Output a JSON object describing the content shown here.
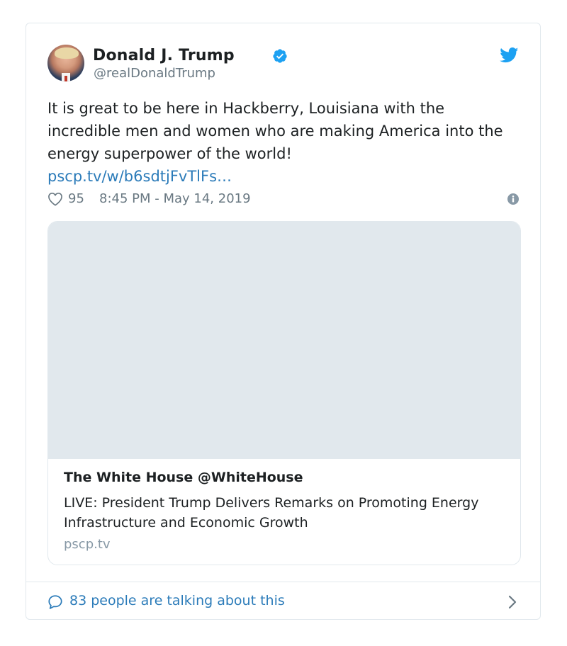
{
  "author": {
    "name": "Donald J. Trump",
    "handle": "@realDonaldTrump"
  },
  "tweet": {
    "text": "It is great to be here in Hackberry, Louisiana with the incredible men and women who are making America into the energy superpower of the world!",
    "link": "pscp.tv/w/b6sdtjFvTlFs…"
  },
  "meta": {
    "like_count": "95",
    "timestamp": "8:45 PM - May 14, 2019"
  },
  "card": {
    "title": "The White House @WhiteHouse",
    "description": "LIVE: President Trump Delivers Remarks on Promoting Energy Infrastructure and Economic Growth",
    "domain": "pscp.tv"
  },
  "footer": {
    "talking": "83 people are talking about this"
  },
  "colors": {
    "link": "#2b7bb9",
    "twitter_blue": "#1da1f2",
    "muted": "#697882",
    "border": "#e1e8ed"
  },
  "icons": {
    "verified": "verified-badge-icon",
    "brand": "twitter-bird-icon",
    "like": "heart-icon",
    "info": "info-icon",
    "reply": "speech-bubble-icon",
    "more": "chevron-right-icon"
  }
}
